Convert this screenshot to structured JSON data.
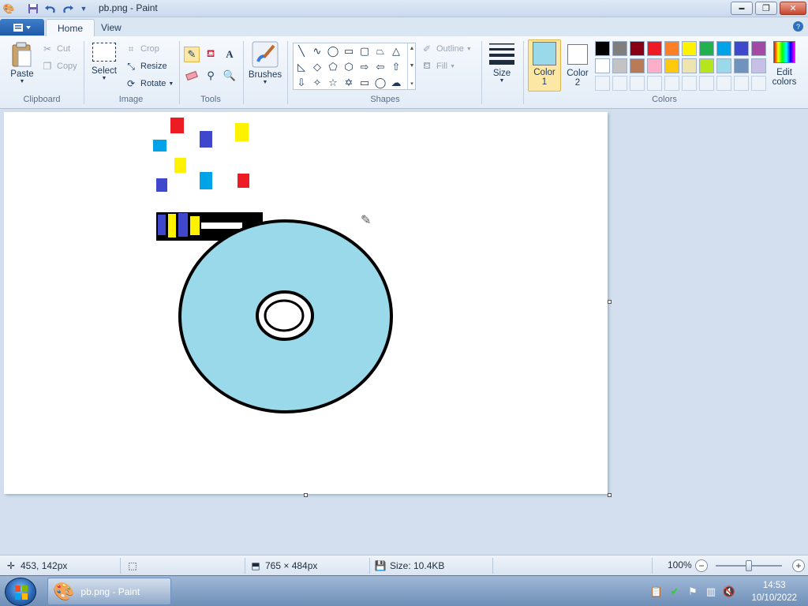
{
  "window": {
    "title": "pb.png - Paint",
    "controls": {
      "minimize": "▬",
      "maximize": "❐",
      "close": "✕"
    }
  },
  "quick_access": {
    "icons": [
      "paint-menu-icon",
      "save-icon",
      "undo-icon",
      "redo-icon",
      "customize-quick-access-icon"
    ]
  },
  "tabs": {
    "home": "Home",
    "view": "View"
  },
  "ribbon": {
    "clipboard": {
      "label": "Clipboard",
      "paste": "Paste",
      "cut": "Cut",
      "copy": "Copy"
    },
    "image": {
      "label": "Image",
      "select": "Select",
      "crop": "Crop",
      "resize": "Resize",
      "rotate": "Rotate"
    },
    "tools": {
      "label": "Tools"
    },
    "brushes": {
      "label": "Brushes"
    },
    "shapes": {
      "label": "Shapes",
      "outline": "Outline",
      "fill": "Fill"
    },
    "size": {
      "label": "Size"
    },
    "colors": {
      "label": "Colors",
      "color1_label": "Color",
      "color1_num": "1",
      "color2_label": "Color",
      "color2_num": "2",
      "edit": "Edit",
      "edit2": "colors",
      "color1_value": "#99d9ea",
      "color2_value": "#ffffff",
      "palette_row1": [
        "#000000",
        "#7f7f7f",
        "#880015",
        "#ed1c24",
        "#ff7f27",
        "#fff200",
        "#22b14c",
        "#00a2e8",
        "#3f48cc",
        "#a349a4"
      ],
      "palette_row2": [
        "#ffffff",
        "#c3c3c3",
        "#b97a57",
        "#ffaec9",
        "#ffc90e",
        "#efe4b0",
        "#b5e61d",
        "#99d9ea",
        "#7092be",
        "#c8bfe7"
      ]
    }
  },
  "canvas_drawing": {
    "disc_fill": "#99d9ea",
    "outline": "#000000",
    "confetti_colors": [
      "#ed1c24",
      "#00a2e8",
      "#3f48cc",
      "#fff200"
    ]
  },
  "status": {
    "cursor_pos": "453, 142px",
    "selection_size": "",
    "image_size": "765 × 484px",
    "file_size": "Size: 10.4KB",
    "zoom": "100%",
    "zoom_level": 1.0
  },
  "taskbar": {
    "paint_task": "pb.png - Paint",
    "time": "14:53",
    "date": "10/10/2022"
  }
}
